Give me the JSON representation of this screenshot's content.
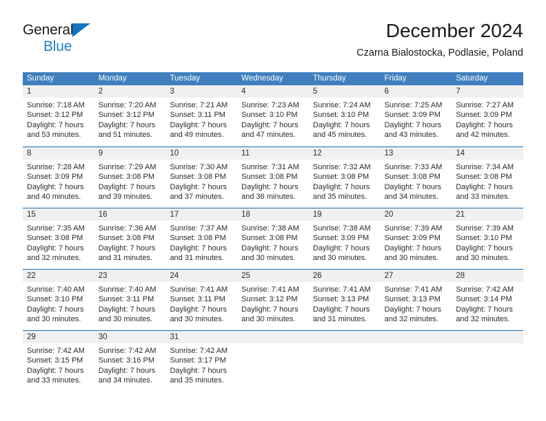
{
  "brand": {
    "name_top": "General",
    "name_bottom": "Blue",
    "triangle_color": "#1574bb",
    "blue_color": "#1f7fc4"
  },
  "header": {
    "title": "December 2024",
    "subtitle": "Czarna Bialostocka, Podlasie, Poland"
  },
  "colors": {
    "header_row_bg": "#3f7fbf",
    "cell_rule": "#1b6cb0",
    "daynum_band": "#f0f0f0",
    "text": "#2a2a2a"
  },
  "weekday_headers": [
    "Sunday",
    "Monday",
    "Tuesday",
    "Wednesday",
    "Thursday",
    "Friday",
    "Saturday"
  ],
  "weeks": [
    [
      {
        "day": "1",
        "sunrise": "Sunrise: 7:18 AM",
        "sunset": "Sunset: 3:12 PM",
        "daylight1": "Daylight: 7 hours",
        "daylight2": "and 53 minutes."
      },
      {
        "day": "2",
        "sunrise": "Sunrise: 7:20 AM",
        "sunset": "Sunset: 3:12 PM",
        "daylight1": "Daylight: 7 hours",
        "daylight2": "and 51 minutes."
      },
      {
        "day": "3",
        "sunrise": "Sunrise: 7:21 AM",
        "sunset": "Sunset: 3:11 PM",
        "daylight1": "Daylight: 7 hours",
        "daylight2": "and 49 minutes."
      },
      {
        "day": "4",
        "sunrise": "Sunrise: 7:23 AM",
        "sunset": "Sunset: 3:10 PM",
        "daylight1": "Daylight: 7 hours",
        "daylight2": "and 47 minutes."
      },
      {
        "day": "5",
        "sunrise": "Sunrise: 7:24 AM",
        "sunset": "Sunset: 3:10 PM",
        "daylight1": "Daylight: 7 hours",
        "daylight2": "and 45 minutes."
      },
      {
        "day": "6",
        "sunrise": "Sunrise: 7:25 AM",
        "sunset": "Sunset: 3:09 PM",
        "daylight1": "Daylight: 7 hours",
        "daylight2": "and 43 minutes."
      },
      {
        "day": "7",
        "sunrise": "Sunrise: 7:27 AM",
        "sunset": "Sunset: 3:09 PM",
        "daylight1": "Daylight: 7 hours",
        "daylight2": "and 42 minutes."
      }
    ],
    [
      {
        "day": "8",
        "sunrise": "Sunrise: 7:28 AM",
        "sunset": "Sunset: 3:09 PM",
        "daylight1": "Daylight: 7 hours",
        "daylight2": "and 40 minutes."
      },
      {
        "day": "9",
        "sunrise": "Sunrise: 7:29 AM",
        "sunset": "Sunset: 3:08 PM",
        "daylight1": "Daylight: 7 hours",
        "daylight2": "and 39 minutes."
      },
      {
        "day": "10",
        "sunrise": "Sunrise: 7:30 AM",
        "sunset": "Sunset: 3:08 PM",
        "daylight1": "Daylight: 7 hours",
        "daylight2": "and 37 minutes."
      },
      {
        "day": "11",
        "sunrise": "Sunrise: 7:31 AM",
        "sunset": "Sunset: 3:08 PM",
        "daylight1": "Daylight: 7 hours",
        "daylight2": "and 36 minutes."
      },
      {
        "day": "12",
        "sunrise": "Sunrise: 7:32 AM",
        "sunset": "Sunset: 3:08 PM",
        "daylight1": "Daylight: 7 hours",
        "daylight2": "and 35 minutes."
      },
      {
        "day": "13",
        "sunrise": "Sunrise: 7:33 AM",
        "sunset": "Sunset: 3:08 PM",
        "daylight1": "Daylight: 7 hours",
        "daylight2": "and 34 minutes."
      },
      {
        "day": "14",
        "sunrise": "Sunrise: 7:34 AM",
        "sunset": "Sunset: 3:08 PM",
        "daylight1": "Daylight: 7 hours",
        "daylight2": "and 33 minutes."
      }
    ],
    [
      {
        "day": "15",
        "sunrise": "Sunrise: 7:35 AM",
        "sunset": "Sunset: 3:08 PM",
        "daylight1": "Daylight: 7 hours",
        "daylight2": "and 32 minutes."
      },
      {
        "day": "16",
        "sunrise": "Sunrise: 7:36 AM",
        "sunset": "Sunset: 3:08 PM",
        "daylight1": "Daylight: 7 hours",
        "daylight2": "and 31 minutes."
      },
      {
        "day": "17",
        "sunrise": "Sunrise: 7:37 AM",
        "sunset": "Sunset: 3:08 PM",
        "daylight1": "Daylight: 7 hours",
        "daylight2": "and 31 minutes."
      },
      {
        "day": "18",
        "sunrise": "Sunrise: 7:38 AM",
        "sunset": "Sunset: 3:08 PM",
        "daylight1": "Daylight: 7 hours",
        "daylight2": "and 30 minutes."
      },
      {
        "day": "19",
        "sunrise": "Sunrise: 7:38 AM",
        "sunset": "Sunset: 3:09 PM",
        "daylight1": "Daylight: 7 hours",
        "daylight2": "and 30 minutes."
      },
      {
        "day": "20",
        "sunrise": "Sunrise: 7:39 AM",
        "sunset": "Sunset: 3:09 PM",
        "daylight1": "Daylight: 7 hours",
        "daylight2": "and 30 minutes."
      },
      {
        "day": "21",
        "sunrise": "Sunrise: 7:39 AM",
        "sunset": "Sunset: 3:10 PM",
        "daylight1": "Daylight: 7 hours",
        "daylight2": "and 30 minutes."
      }
    ],
    [
      {
        "day": "22",
        "sunrise": "Sunrise: 7:40 AM",
        "sunset": "Sunset: 3:10 PM",
        "daylight1": "Daylight: 7 hours",
        "daylight2": "and 30 minutes."
      },
      {
        "day": "23",
        "sunrise": "Sunrise: 7:40 AM",
        "sunset": "Sunset: 3:11 PM",
        "daylight1": "Daylight: 7 hours",
        "daylight2": "and 30 minutes."
      },
      {
        "day": "24",
        "sunrise": "Sunrise: 7:41 AM",
        "sunset": "Sunset: 3:11 PM",
        "daylight1": "Daylight: 7 hours",
        "daylight2": "and 30 minutes."
      },
      {
        "day": "25",
        "sunrise": "Sunrise: 7:41 AM",
        "sunset": "Sunset: 3:12 PM",
        "daylight1": "Daylight: 7 hours",
        "daylight2": "and 30 minutes."
      },
      {
        "day": "26",
        "sunrise": "Sunrise: 7:41 AM",
        "sunset": "Sunset: 3:13 PM",
        "daylight1": "Daylight: 7 hours",
        "daylight2": "and 31 minutes."
      },
      {
        "day": "27",
        "sunrise": "Sunrise: 7:41 AM",
        "sunset": "Sunset: 3:13 PM",
        "daylight1": "Daylight: 7 hours",
        "daylight2": "and 32 minutes."
      },
      {
        "day": "28",
        "sunrise": "Sunrise: 7:42 AM",
        "sunset": "Sunset: 3:14 PM",
        "daylight1": "Daylight: 7 hours",
        "daylight2": "and 32 minutes."
      }
    ],
    [
      {
        "day": "29",
        "sunrise": "Sunrise: 7:42 AM",
        "sunset": "Sunset: 3:15 PM",
        "daylight1": "Daylight: 7 hours",
        "daylight2": "and 33 minutes."
      },
      {
        "day": "30",
        "sunrise": "Sunrise: 7:42 AM",
        "sunset": "Sunset: 3:16 PM",
        "daylight1": "Daylight: 7 hours",
        "daylight2": "and 34 minutes."
      },
      {
        "day": "31",
        "sunrise": "Sunrise: 7:42 AM",
        "sunset": "Sunset: 3:17 PM",
        "daylight1": "Daylight: 7 hours",
        "daylight2": "and 35 minutes."
      },
      {
        "day": "",
        "sunrise": "",
        "sunset": "",
        "daylight1": "",
        "daylight2": ""
      },
      {
        "day": "",
        "sunrise": "",
        "sunset": "",
        "daylight1": "",
        "daylight2": ""
      },
      {
        "day": "",
        "sunrise": "",
        "sunset": "",
        "daylight1": "",
        "daylight2": ""
      },
      {
        "day": "",
        "sunrise": "",
        "sunset": "",
        "daylight1": "",
        "daylight2": ""
      }
    ]
  ]
}
